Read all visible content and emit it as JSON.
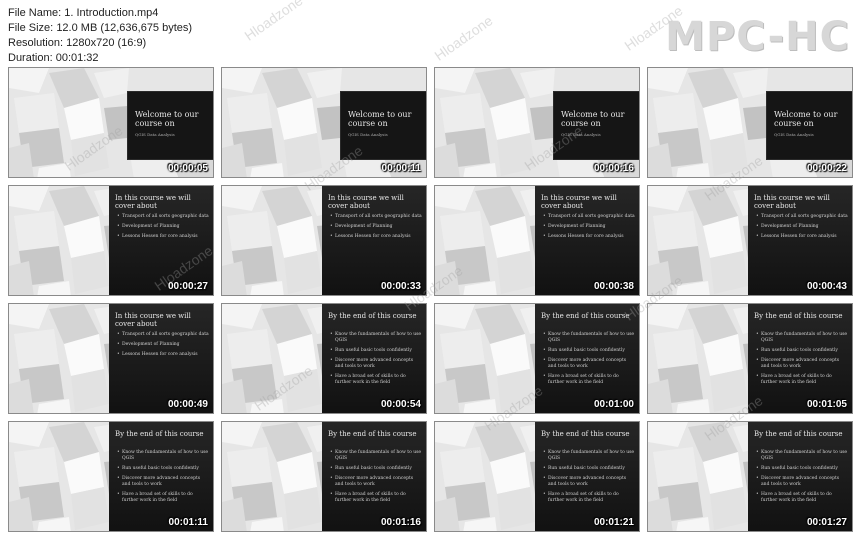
{
  "file_info": {
    "name_label": "File Name:",
    "name": "1. Introduction.mp4",
    "size_label": "File Size:",
    "size": "12.0 MB (12,636,675 bytes)",
    "resolution_label": "Resolution:",
    "resolution": "1280x720 (16:9)",
    "duration_label": "Duration:",
    "duration": "00:01:32"
  },
  "logo": "MPC-HC",
  "watermark": "Hloadzone",
  "slides": {
    "welcome_title": "Welcome to our course on",
    "welcome_sub": "QGIS Data Analysis",
    "course_title": "In this course we will cover about",
    "course_bullets": [
      "Transport of all sorts geographic data",
      "Development of Planning",
      "Lessons Hessen for core analysis"
    ],
    "end_title": "By the end of this course",
    "end_bullets": [
      "Know the fundamentals of how to use QGIS",
      "Run useful basic tools confidently",
      "Discover more advanced concepts and tools to work",
      "Have a broad set of skills to do further work in the field"
    ]
  },
  "thumbnails": [
    {
      "time": "00:00:05",
      "type": "welcome"
    },
    {
      "time": "00:00:11",
      "type": "welcome"
    },
    {
      "time": "00:00:16",
      "type": "welcome"
    },
    {
      "time": "00:00:22",
      "type": "welcome"
    },
    {
      "time": "00:00:27",
      "type": "course"
    },
    {
      "time": "00:00:33",
      "type": "course"
    },
    {
      "time": "00:00:38",
      "type": "course"
    },
    {
      "time": "00:00:43",
      "type": "course"
    },
    {
      "time": "00:00:49",
      "type": "course"
    },
    {
      "time": "00:00:54",
      "type": "end"
    },
    {
      "time": "00:01:00",
      "type": "end"
    },
    {
      "time": "00:01:05",
      "type": "end"
    },
    {
      "time": "00:01:11",
      "type": "end"
    },
    {
      "time": "00:01:16",
      "type": "end"
    },
    {
      "time": "00:01:21",
      "type": "end"
    },
    {
      "time": "00:01:27",
      "type": "end"
    }
  ]
}
